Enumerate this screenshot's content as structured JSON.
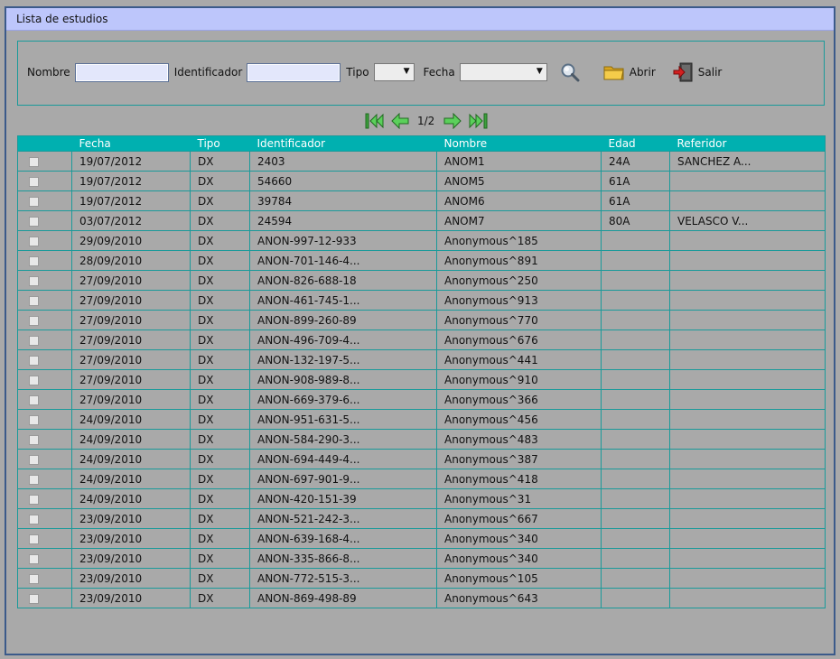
{
  "window": {
    "title": "Lista de estudios"
  },
  "filters": {
    "nombre_label": "Nombre",
    "nombre_value": "",
    "identificador_label": "Identificador",
    "identificador_value": "",
    "tipo_label": "Tipo",
    "tipo_value": "",
    "fecha_label": "Fecha",
    "fecha_value": "",
    "abrir_label": "Abrir",
    "salir_label": "Salir"
  },
  "pager": {
    "page_text": "1/2"
  },
  "colors": {
    "header": "#00b0b0",
    "title_bar": "#bdc6fb",
    "border": "#1a9a9a"
  },
  "table": {
    "headers": [
      "",
      "Fecha",
      "Tipo",
      "Identificador",
      "Nombre",
      "Edad",
      "Referidor"
    ],
    "rows": [
      [
        "19/07/2012",
        "DX",
        "2403",
        "ANOM1",
        "24A",
        "SANCHEZ A..."
      ],
      [
        "19/07/2012",
        "DX",
        "54660",
        "ANOM5",
        "61A",
        ""
      ],
      [
        "19/07/2012",
        "DX",
        "39784",
        "ANOM6",
        "61A",
        ""
      ],
      [
        "03/07/2012",
        "DX",
        "24594",
        "ANOM7",
        "80A",
        "VELASCO V..."
      ],
      [
        "29/09/2010",
        "DX",
        "ANON-997-12-933",
        "Anonymous^185",
        "",
        ""
      ],
      [
        "28/09/2010",
        "DX",
        "ANON-701-146-4...",
        "Anonymous^891",
        "",
        ""
      ],
      [
        "27/09/2010",
        "DX",
        "ANON-826-688-18",
        "Anonymous^250",
        "",
        ""
      ],
      [
        "27/09/2010",
        "DX",
        "ANON-461-745-1...",
        "Anonymous^913",
        "",
        ""
      ],
      [
        "27/09/2010",
        "DX",
        "ANON-899-260-89",
        "Anonymous^770",
        "",
        ""
      ],
      [
        "27/09/2010",
        "DX",
        "ANON-496-709-4...",
        "Anonymous^676",
        "",
        ""
      ],
      [
        "27/09/2010",
        "DX",
        "ANON-132-197-5...",
        "Anonymous^441",
        "",
        ""
      ],
      [
        "27/09/2010",
        "DX",
        "ANON-908-989-8...",
        "Anonymous^910",
        "",
        ""
      ],
      [
        "27/09/2010",
        "DX",
        "ANON-669-379-6...",
        "Anonymous^366",
        "",
        ""
      ],
      [
        "24/09/2010",
        "DX",
        "ANON-951-631-5...",
        "Anonymous^456",
        "",
        ""
      ],
      [
        "24/09/2010",
        "DX",
        "ANON-584-290-3...",
        "Anonymous^483",
        "",
        ""
      ],
      [
        "24/09/2010",
        "DX",
        "ANON-694-449-4...",
        "Anonymous^387",
        "",
        ""
      ],
      [
        "24/09/2010",
        "DX",
        "ANON-697-901-9...",
        "Anonymous^418",
        "",
        ""
      ],
      [
        "24/09/2010",
        "DX",
        "ANON-420-151-39",
        "Anonymous^31",
        "",
        ""
      ],
      [
        "23/09/2010",
        "DX",
        "ANON-521-242-3...",
        "Anonymous^667",
        "",
        ""
      ],
      [
        "23/09/2010",
        "DX",
        "ANON-639-168-4...",
        "Anonymous^340",
        "",
        ""
      ],
      [
        "23/09/2010",
        "DX",
        "ANON-335-866-8...",
        "Anonymous^340",
        "",
        ""
      ],
      [
        "23/09/2010",
        "DX",
        "ANON-772-515-3...",
        "Anonymous^105",
        "",
        ""
      ],
      [
        "23/09/2010",
        "DX",
        "ANON-869-498-89",
        "Anonymous^643",
        "",
        ""
      ]
    ]
  }
}
